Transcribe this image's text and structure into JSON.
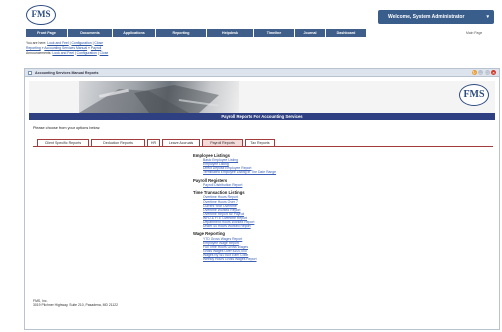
{
  "header": {
    "logo_text": "FMS",
    "welcome": "Welcome, System Administrator",
    "help_link": "Main Page"
  },
  "nav": [
    "Front Page",
    "Documents",
    "Applications",
    "Reporting",
    "Helpdesk",
    "Timeline",
    "Journal",
    "Dashboard"
  ],
  "breadcrumbs": {
    "line1_prefix": "You are here:",
    "line1_links": [
      "Look and Feel",
      "Configuration",
      "Close"
    ],
    "line2_links": [
      "Reporting",
      "Accounting Services Manual",
      "Payroll"
    ],
    "line3_prefix": "Announcements:",
    "line3_links": [
      "Look and Feel",
      "Configuration",
      "Close"
    ]
  },
  "window": {
    "title": "Accounting Services Manual Reports"
  },
  "page": {
    "heading": "Payroll Reports For Accounting Services",
    "intro": "Please choose from your options below:"
  },
  "tabs": [
    "Client Specific Reports",
    "Deduction Reports",
    "HR",
    "Leave Accruals",
    "Payroll Reports",
    "Tax Reports"
  ],
  "active_tab": "Payroll Reports",
  "sections": [
    {
      "title": "Employee Listings",
      "links": [
        "Basic Employee Listing",
        "Employee Listing",
        "Direct Deposit Employee Report",
        "Terminated Employee Listing In The Date Range"
      ]
    },
    {
      "title": "Payroll Registers",
      "links": [
        "Payroll Distribution Report"
      ]
    },
    {
      "title": "Time Transaction Listings",
      "links": [
        "Overtime Hours Report",
        "Overtime Hours Over 7",
        "Current Year Overtime",
        "Overtime Worked Report",
        "Overtime Report for Payroll",
        "WFD & FTE Overtime Report",
        "Department Hours Worked Report",
        "Under 40 Hours Worked Report"
      ]
    },
    {
      "title": "Wage Reporting",
      "links": [
        "YTD Gross Wages Report",
        "Employee Wage Report",
        "Full Time Hours Gross Wages",
        "Gross Wages Over $100,000",
        "Wages By W2 Box Earn Code",
        "Weekly Hours Gross Wages Report"
      ]
    }
  ],
  "footer": {
    "company": "FMS, Inc.",
    "address": "3019 Pilchner Highway, Suite 210, Pasadena, MD 21122"
  },
  "colors": {
    "nav_blue": "#3f5f8a",
    "heading_navy": "#2e3f82",
    "tab_border": "#a33c3c",
    "link_blue": "#3b5fb5"
  }
}
